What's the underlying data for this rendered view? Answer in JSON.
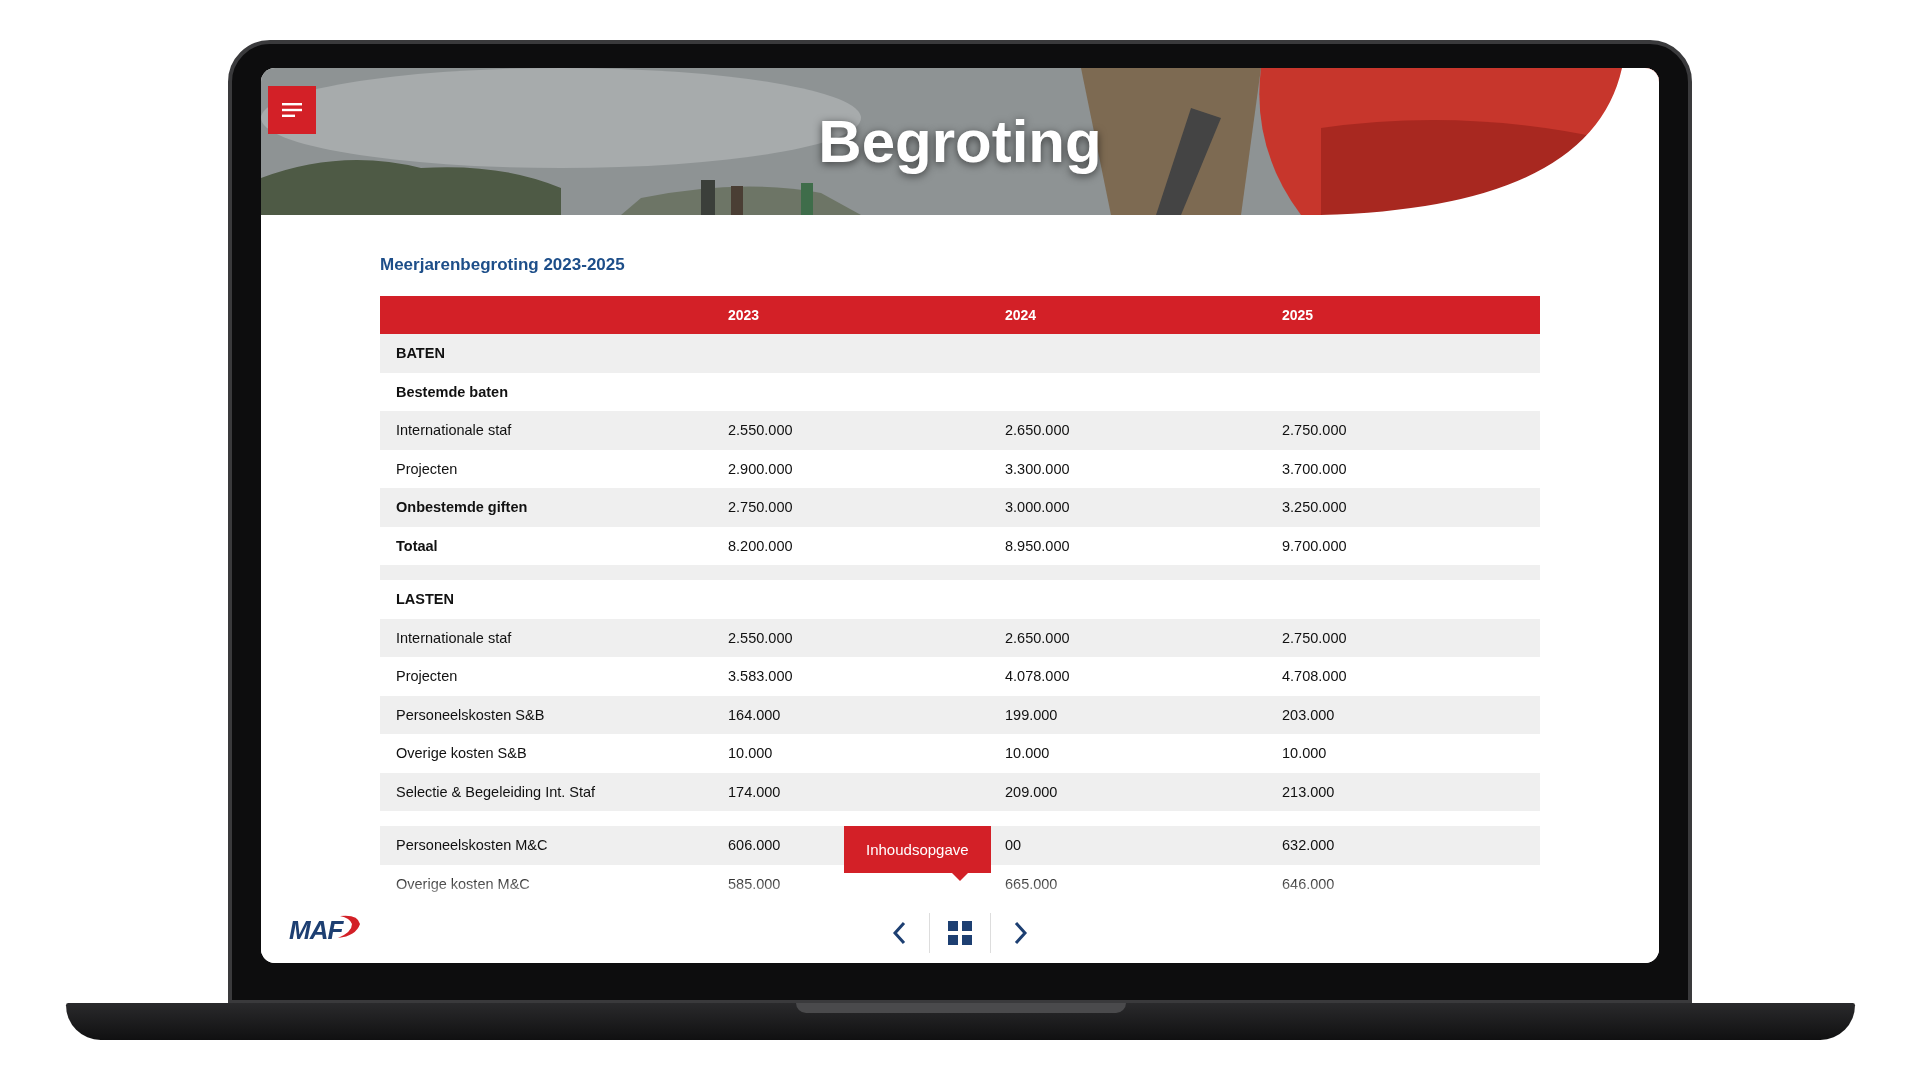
{
  "header": {
    "title": "Begroting"
  },
  "section_title": "Meerjarenbegroting 2023-2025",
  "table": {
    "columns": [
      "",
      "2023",
      "2024",
      "2025"
    ],
    "rows": [
      {
        "kind": "heading",
        "cells": [
          "BATEN"
        ]
      },
      {
        "kind": "total",
        "cells": [
          "Bestemde baten"
        ]
      },
      {
        "kind": "item",
        "cells": [
          "Internationale staf",
          "2.550.000",
          "2.650.000",
          "2.750.000"
        ]
      },
      {
        "kind": "item",
        "cells": [
          "Projecten",
          "2.900.000",
          "3.300.000",
          "3.700.000"
        ]
      },
      {
        "kind": "total",
        "cells": [
          "Onbestemde giften",
          "2.750.000",
          "3.000.000",
          "3.250.000"
        ]
      },
      {
        "kind": "total",
        "cells": [
          "Totaal",
          "8.200.000",
          "8.950.000",
          "9.700.000"
        ]
      },
      {
        "kind": "spacer",
        "cells": []
      },
      {
        "kind": "heading",
        "cells": [
          "LASTEN"
        ]
      },
      {
        "kind": "item",
        "cells": [
          "Internationale staf",
          "2.550.000",
          "2.650.000",
          "2.750.000"
        ]
      },
      {
        "kind": "item",
        "cells": [
          "Projecten",
          "3.583.000",
          "4.078.000",
          "4.708.000"
        ]
      },
      {
        "kind": "item",
        "cells": [
          "Personeelskosten S&B",
          "164.000",
          "199.000",
          "203.000"
        ]
      },
      {
        "kind": "item",
        "cells": [
          "Overige kosten S&B",
          "10.000",
          "10.000",
          "10.000"
        ]
      },
      {
        "kind": "item",
        "cells": [
          "Selectie & Begeleiding Int. Staf",
          "174.000",
          "209.000",
          "213.000"
        ]
      },
      {
        "kind": "spacer",
        "cells": []
      },
      {
        "kind": "item",
        "cells": [
          "Personeelskosten M&C",
          "606.000",
          "00",
          "632.000"
        ]
      },
      {
        "kind": "item",
        "cells": [
          "Overige kosten M&C",
          "585.000",
          "665.000",
          "646.000"
        ]
      }
    ]
  },
  "footer": {
    "logo": "MAF",
    "tooltip": "Inhoudsopgave"
  }
}
